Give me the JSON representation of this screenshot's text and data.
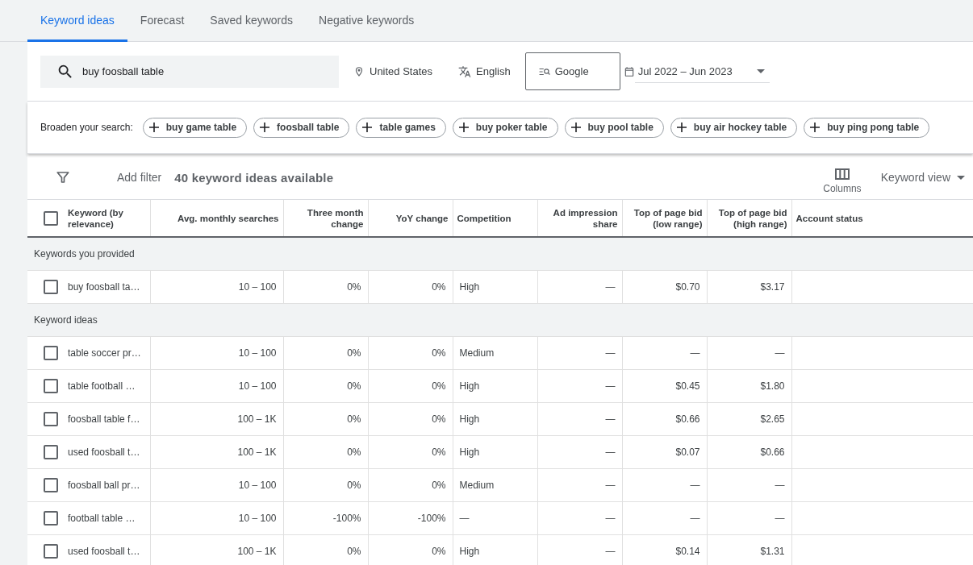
{
  "tabs": [
    {
      "label": "Keyword ideas",
      "selected": true
    },
    {
      "label": "Forecast",
      "selected": false
    },
    {
      "label": "Saved keywords",
      "selected": false
    },
    {
      "label": "Negative keywords",
      "selected": false
    }
  ],
  "search": {
    "value": "buy foosball table"
  },
  "location": "United States",
  "language": "English",
  "network": "Google",
  "date_range": "Jul 2022 – Jun 2023",
  "broaden": {
    "label": "Broaden your search:",
    "chips": [
      "buy game table",
      "foosball table",
      "table games",
      "buy poker table",
      "buy pool table",
      "buy air hockey table",
      "buy ping pong table"
    ]
  },
  "toolbar": {
    "add_filter": "Add filter",
    "count": "40 keyword ideas available",
    "columns": "Columns",
    "view": "Keyword view"
  },
  "table": {
    "select_all": false,
    "columns": [
      "Keyword (by relevance)",
      "Avg. monthly searches",
      "Three month change",
      "YoY change",
      "Competition",
      "Ad impression share",
      "Top of page bid (low range)",
      "Top of page bid (high range)",
      "Account status"
    ],
    "groups": [
      {
        "title": "Keywords you provided",
        "rows": [
          {
            "checked": false,
            "cells": [
              "buy foosball ta…",
              "10 – 100",
              "0%",
              "0%",
              "High",
              "—",
              "$0.70",
              "$3.17"
            ]
          }
        ]
      },
      {
        "title": "Keyword ideas",
        "rows": [
          {
            "checked": false,
            "cells": [
              "table soccer pr…",
              "10 – 100",
              "0%",
              "0%",
              "Medium",
              "—",
              "—",
              "—"
            ]
          },
          {
            "checked": false,
            "cells": [
              "table football …",
              "10 – 100",
              "0%",
              "0%",
              "High",
              "—",
              "$0.45",
              "$1.80"
            ]
          },
          {
            "checked": false,
            "cells": [
              "foosball table f…",
              "100 – 1K",
              "0%",
              "0%",
              "High",
              "—",
              "$0.66",
              "$2.65"
            ]
          },
          {
            "checked": false,
            "cells": [
              "used foosball t…",
              "100 – 1K",
              "0%",
              "0%",
              "High",
              "—",
              "$0.07",
              "$0.66"
            ]
          },
          {
            "checked": false,
            "cells": [
              "foosball ball pr…",
              "10 – 100",
              "0%",
              "0%",
              "Medium",
              "—",
              "—",
              "—"
            ]
          },
          {
            "checked": false,
            "cells": [
              "football table …",
              "10 – 100",
              "-100%",
              "-100%",
              "—",
              "—",
              "—",
              "—"
            ]
          },
          {
            "checked": false,
            "cells": [
              "used foosball t…",
              "100 – 1K",
              "0%",
              "0%",
              "High",
              "—",
              "$0.14",
              "$1.31"
            ]
          }
        ]
      }
    ]
  }
}
